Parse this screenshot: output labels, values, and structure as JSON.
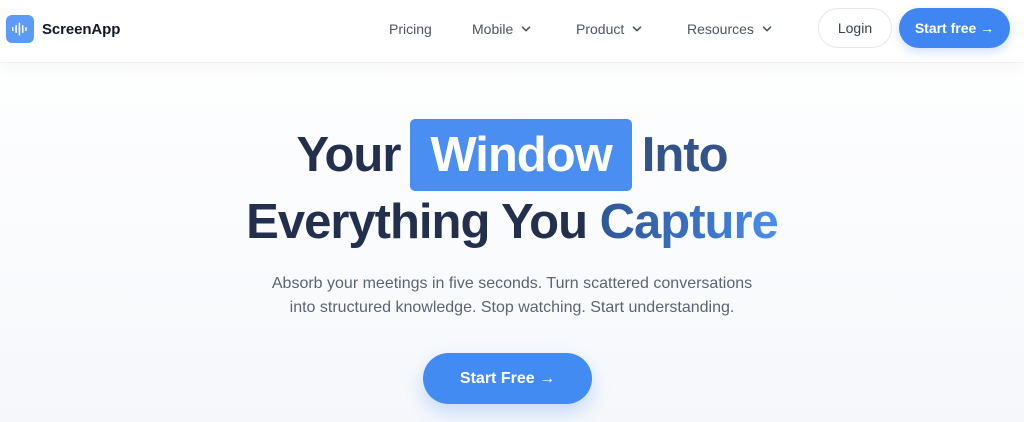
{
  "brand": {
    "name": "ScreenApp",
    "accent": "#4a8ef1"
  },
  "nav": {
    "items": [
      {
        "label": "Pricing",
        "has_dropdown": false
      },
      {
        "label": "Mobile",
        "has_dropdown": true
      },
      {
        "label": "Product",
        "has_dropdown": true
      },
      {
        "label": "Resources",
        "has_dropdown": true
      }
    ],
    "login_label": "Login",
    "start_label": "Start free →"
  },
  "hero": {
    "title_part1": "Your",
    "title_highlight": "Window",
    "title_part2": "Into",
    "title_line2_part1": "Everything You",
    "title_line2_part2": "Capture",
    "subtitle_line1": "Absorb your meetings in five seconds. Turn scattered conversations",
    "subtitle_line2": "into structured knowledge. Stop watching. Start understanding.",
    "cta_label": "Start Free →"
  },
  "icons": {
    "logo": "waveform-icon",
    "dropdown": "chevron-down-icon"
  }
}
